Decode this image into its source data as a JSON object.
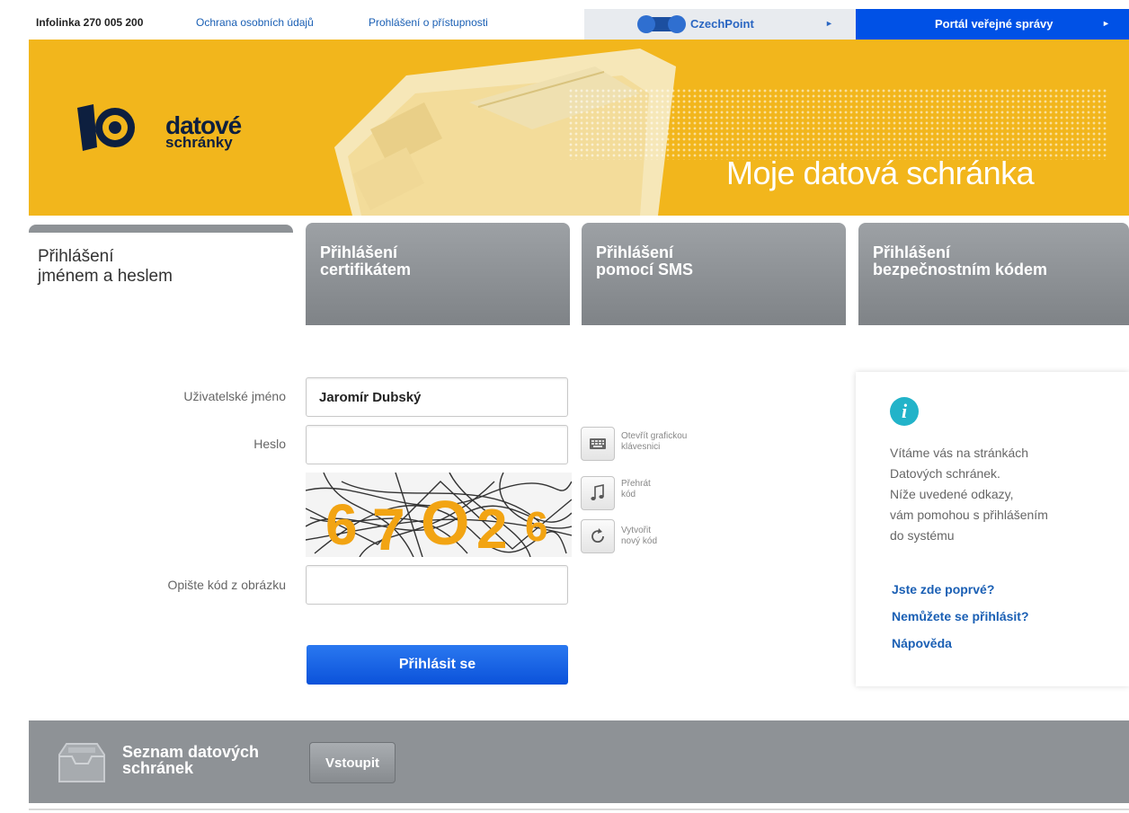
{
  "topbar": {
    "infolinka": "Infolinka 270 005 200",
    "privacy_link": "Ochrana osobních údajů",
    "accessibility_link": "Prohlášení o přístupnosti",
    "czechpoint_label": "CzechPoint",
    "portal_label": "Portál veřejné správy",
    "arrow": "►"
  },
  "banner": {
    "logo_line1": "datové",
    "logo_line2": "schránky",
    "title": "Moje datová schránka"
  },
  "tabs": [
    {
      "line1": "Přihlášení",
      "line2": "jménem a heslem",
      "active": true
    },
    {
      "line1": "Přihlášení",
      "line2": "certifikátem",
      "active": false
    },
    {
      "line1": "Přihlášení",
      "line2": "pomocí SMS",
      "active": false
    },
    {
      "line1": "Přihlášení",
      "line2": "bezpečnostním kódem",
      "active": false
    }
  ],
  "form": {
    "username_label": "Uživatelské jméno",
    "username_value": "Jaromír Dubský",
    "password_label": "Heslo",
    "password_value": "",
    "keyboard_text_1": "Otevřít grafickou",
    "keyboard_text_2": "klávesnici",
    "play_text_1": "Přehrát",
    "play_text_2": "kód",
    "refresh_text_1": "Vytvořit",
    "refresh_text_2": "nový kód",
    "captcha_label": "Opište kód z obrázku",
    "captcha_value": "",
    "captcha_chars": [
      "6",
      "7",
      "O",
      "2",
      "6"
    ],
    "login_button": "Přihlásit se"
  },
  "info": {
    "lines": [
      "Vítáme vás na stránkách",
      "Datových schránek.",
      "Níže uvedené odkazy,",
      "vám pomohou s přihlášením",
      "do systému"
    ],
    "links": [
      "Jste zde poprvé?",
      "Nemůžete se přihlásit?",
      "Nápověda"
    ]
  },
  "bottom": {
    "title_line1": "Seznam datových",
    "title_line2": "schránek",
    "enter_button": "Vstoupit"
  },
  "colors": {
    "banner": "#f2b61c",
    "portal": "#0051e6",
    "tab_gray": "#8e9296",
    "login_button": "#0b52da",
    "info_icon": "#22b3c9"
  }
}
